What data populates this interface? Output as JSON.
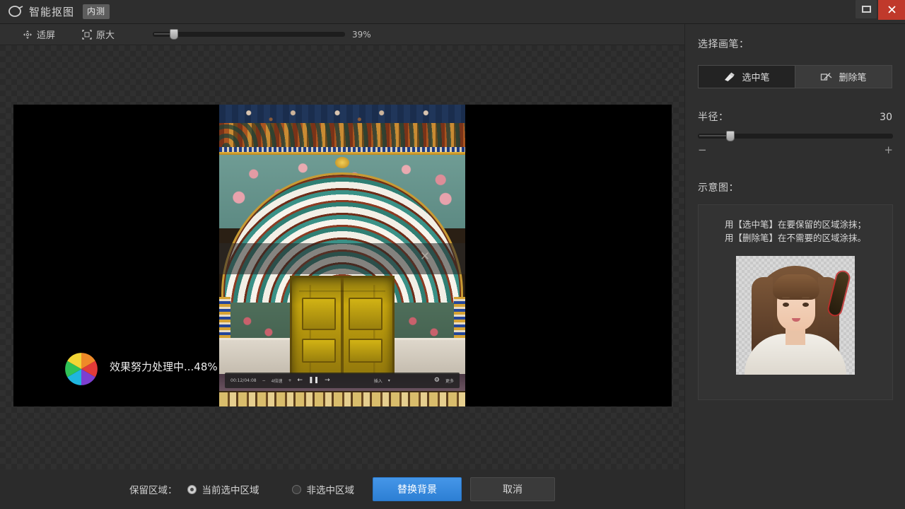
{
  "titlebar": {
    "logo_icon": "scissors-cutout-icon",
    "title": "智能抠图",
    "badge": "内测",
    "maximize_icon": "maximize-icon",
    "close_icon": "close-icon"
  },
  "toolbar": {
    "fit_icon": "fit-screen-icon",
    "fit_label": "适屏",
    "original_icon": "original-size-icon",
    "original_label": "原大",
    "zoom_percent": "39%",
    "zoom_value": 39
  },
  "canvas": {
    "image_description": "印度斋普尔城市宫殿孔雀门",
    "mini_player": {
      "time": "00:12/04:08",
      "speed_minus": "−",
      "speed_label": "4倍速",
      "speed_plus": "+",
      "prev_icon": "step-backward-icon",
      "pause_icon": "pause-icon",
      "next_icon": "step-forward-icon",
      "insert_label": "插入",
      "dropdown_icon": "chevron-down-icon",
      "settings_icon": "gear-icon",
      "settings_label": "更多"
    },
    "processing": {
      "spinner_icon": "aperture-spinner-icon",
      "text": "效果努力处理中...48%",
      "percent": 48,
      "close_icon": "close-icon"
    }
  },
  "right_panel": {
    "brush_section_label": "选择画笔：",
    "brushes": [
      {
        "id": "select",
        "label": "选中笔",
        "icon": "marker-pen-icon",
        "active": true
      },
      {
        "id": "erase",
        "label": "删除笔",
        "icon": "eraser-icon",
        "active": false
      }
    ],
    "radius_label": "半径：",
    "radius_value": "30",
    "radius_minus": "−",
    "radius_plus": "+",
    "demo_label": "示意图：",
    "demo_lines": [
      "用【选中笔】在要保留的区域涂抹；",
      "用【删除笔】在不需要的区域涂抹。"
    ],
    "demo_image_alt": "示意图：人像与涂抹笔迹"
  },
  "bottom_bar": {
    "keep_label": "保留区域：",
    "options": [
      {
        "label": "当前选中区域",
        "checked": true
      },
      {
        "label": "非选中区域",
        "checked": false
      }
    ],
    "primary_button": "替换背景",
    "secondary_button": "取消"
  },
  "colors": {
    "accent_blue": "#3d8ae0",
    "close_red": "#c0392b",
    "panel_bg": "#2f2f2f",
    "window_bg": "#2b2b2b",
    "text": "#d4d4d4"
  }
}
